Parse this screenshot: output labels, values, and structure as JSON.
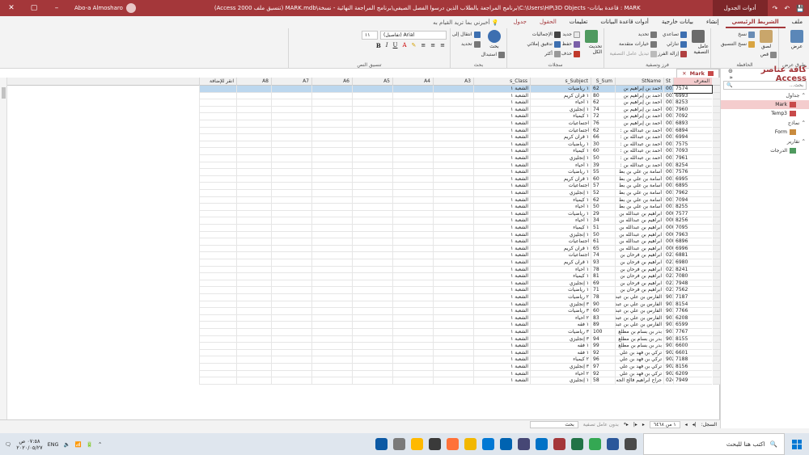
{
  "titlebar": {
    "title": "MARK : قاعدة بيانات- C:\\Users\\HP\\3D Objects\\برنامج المراجعة بالطلاب الذين درسوا الفصل الصيفي\\برنامج المراجعة النهائية - نسخة\\MARK.mdb (تنسيق ملف Access 2000)",
    "context_group": "أدوات الجدول",
    "user": "Abo-a Almosharo",
    "min": "–",
    "max": "▢",
    "close": "✕"
  },
  "tabs": [
    {
      "label": "ملف",
      "active": false
    },
    {
      "label": "الشريط الرئيسي",
      "active": true
    },
    {
      "label": "إنشاء",
      "active": false
    },
    {
      "label": "بيانات خارجية",
      "active": false
    },
    {
      "label": "أدوات قاعدة البيانات",
      "active": false
    },
    {
      "label": "تعليمات",
      "active": false
    },
    {
      "label": "الحقول",
      "active": false,
      "context": true
    },
    {
      "label": "جدول",
      "active": false,
      "context": true
    }
  ],
  "tell_me": "أخبرني بما تريد القيام به",
  "ribbon": {
    "views": {
      "label": "طرق عرض",
      "view_btn": "عرض"
    },
    "clipboard": {
      "label": "الحافظة",
      "paste": "لصق",
      "cut": "قص",
      "copy": "نسخ",
      "format_painter": "نسخ التنسيق"
    },
    "sort_filter": {
      "label": "فرز وتصفية",
      "filter": "عامل التصفية",
      "ascending": "تصاعدي",
      "descending": "تنازلي",
      "remove_sort": "إزالة الفرز",
      "selection": "تحديد",
      "advanced": "خيارات متقدمة",
      "toggle_filter": "تبديل عامل التصفية"
    },
    "records": {
      "label": "سجلات",
      "refresh": "تحديث الكل",
      "new": "جديد",
      "save": "حفظ",
      "delete": "حذف",
      "totals": "الإجماليات",
      "spelling": "تدقيق إملائي",
      "more": "أكثر"
    },
    "find": {
      "label": "بحث",
      "find": "بحث",
      "replace": "استبدال",
      "goto": "انتقال إلى",
      "select": "تحديد"
    },
    "text_format": {
      "label": "تنسيق النص",
      "font": "(تفاصيل) Arial",
      "size": "١١"
    }
  },
  "nav": {
    "title": "كافة عناصر Access",
    "search_placeholder": "بحث...",
    "sections": [
      {
        "label": "جداول",
        "items": [
          "Mark",
          "Temp3"
        ]
      },
      {
        "label": "نماذج",
        "items": [
          "Form"
        ]
      },
      {
        "label": "تقارير",
        "items": [
          "الدرجات"
        ]
      }
    ]
  },
  "doc_tab": "Mark",
  "columns": [
    "المعرف",
    "St",
    "StName",
    "S_Sum",
    "s_Subject",
    "s_Class",
    "A3",
    "A4",
    "A5",
    "A6",
    "A7",
    "A8",
    "انقر للإضافة"
  ],
  "rows": [
    [
      "7574",
      "0010",
      "أحمد بن إبراهيم بن",
      "62",
      "١ رياضيات",
      "الشعبة ١"
    ],
    [
      "6993",
      "0010",
      "أحمد بن إبراهيم بن",
      "80",
      "١ قرآن كريم",
      "الشعبة ١"
    ],
    [
      "8253",
      "0010",
      "أحمد بن إبراهيم بن",
      "62",
      "١ أحياء",
      "الشعبة ١"
    ],
    [
      "7960",
      "0010",
      "أحمد بن إبراهيم بن",
      "74",
      "١ إنجليزي",
      "الشعبة ١"
    ],
    [
      "7092",
      "0010",
      "أحمد بن إبراهيم بن",
      "72",
      "١ كيمياء",
      "الشعبة ١"
    ],
    [
      "6893",
      "0010",
      "أحمد بن إبراهيم بن",
      "76",
      "اجتماعيات",
      "الشعبة ١"
    ],
    [
      "6894",
      "0013",
      "أحمد بن عبدالله بن :",
      "62",
      "اجتماعيات",
      "الشعبة ١"
    ],
    [
      "6994",
      "0013",
      "أحمد بن عبدالله بن :",
      "66",
      "١ قرآن كريم",
      "الشعبة ١"
    ],
    [
      "7575",
      "0013",
      "أحمد بن عبدالله بن :",
      "30",
      "١ رياضيات",
      "الشعبة ١"
    ],
    [
      "7093",
      "0013",
      "أحمد بن عبدالله بن :",
      "60",
      "١ كيمياء",
      "الشعبة ١"
    ],
    [
      "7961",
      "0013",
      "أحمد بن عبدالله بن :",
      "50",
      "١ إنجليزي",
      "الشعبة ١"
    ],
    [
      "8254",
      "0013",
      "أحمد بن عبدالله بن :",
      "39",
      "١ أحياء",
      "الشعبة ١"
    ],
    [
      "7576",
      "0015",
      "أسامة بن علي بن بط",
      "55",
      "١ رياضيات",
      "الشعبة ١"
    ],
    [
      "6995",
      "0015",
      "أسامة بن علي بن بط",
      "60",
      "١ قرآن كريم",
      "الشعبة ١"
    ],
    [
      "6895",
      "0015",
      "أسامة بن علي بن بط",
      "57",
      "اجتماعيات",
      "الشعبة ١"
    ],
    [
      "7962",
      "0015",
      "أسامة بن علي بن بط",
      "52",
      "١ إنجليزي",
      "الشعبة ١"
    ],
    [
      "7094",
      "0015",
      "أسامة بن علي بن بط",
      "62",
      "١ كيمياء",
      "الشعبة ١"
    ],
    [
      "8255",
      "0015",
      "أسامة بن علي بن بط",
      "50",
      "١ أحياء",
      "الشعبة ١"
    ],
    [
      "7577",
      "0001",
      "ابراهيم بن عبدالله بن",
      "29",
      "١ رياضيات",
      "الشعبة ١"
    ],
    [
      "8256",
      "0001",
      "ابراهيم بن عبدالله بن",
      "34",
      "١ أحياء",
      "الشعبة ١"
    ],
    [
      "7095",
      "0001",
      "ابراهيم بن عبدالله بن",
      "51",
      "١ كيمياء",
      "الشعبة ١"
    ],
    [
      "7963",
      "0001",
      "ابراهيم بن عبدالله بن",
      "50",
      "١ إنجليزي",
      "الشعبة ١"
    ],
    [
      "6896",
      "0001",
      "ابراهيم بن عبدالله بن",
      "61",
      "اجتماعيات",
      "الشعبة ١"
    ],
    [
      "6996",
      "0001",
      "ابراهيم بن عبدالله بن",
      "65",
      "١ قرآن كريم",
      "الشعبة ١"
    ],
    [
      "6881",
      "0239",
      "ابراهيم بن فرحان بن",
      "74",
      "اجتماعيات",
      "الشعبة ١"
    ],
    [
      "6980",
      "0239",
      "ابراهيم بن فرحان بن",
      "93",
      "١ قرآن كريم",
      "الشعبة ١"
    ],
    [
      "8241",
      "0239",
      "ابراهيم بن فرحان بن",
      "78",
      "١ أحياء",
      "الشعبة ١"
    ],
    [
      "7080",
      "0239",
      "ابراهيم بن فرحان بن",
      "81",
      "١ كيمياء",
      "الشعبة ١"
    ],
    [
      "7948",
      "0239",
      "ابراهيم بن فرحان بن",
      "69",
      "١ إنجليزي",
      "الشعبة ١"
    ],
    [
      "7562",
      "0239",
      "ابراهيم بن فرحان بن",
      "71",
      "١ رياضيات",
      "الشعبة ١"
    ],
    [
      "7187",
      "9013",
      "الفارس بن علي بن عبد",
      "78",
      "٢ رياضيات",
      "الشعبة ١"
    ],
    [
      "8154",
      "9013",
      "الفارس بن علي بن عبد",
      "90",
      "٣ إنجليزي",
      "الشعبة ١"
    ],
    [
      "7766",
      "9013",
      "الفارس بن علي بن عبد",
      "60",
      "٣ رياضيات",
      "الشعبة ١"
    ],
    [
      "6208",
      "9013",
      "الفارس بن علي بن عبد",
      "83",
      "٢ أحياء",
      "الشعبة ١"
    ],
    [
      "6599",
      "9013",
      "الفارس بن علي بن عبد",
      "89",
      "١ فقه",
      "الشعبة ١"
    ],
    [
      "7767",
      "9018",
      "بدر بن بسام بن مطلع",
      "100",
      "٣ رياضيات",
      "الشعبة ١"
    ],
    [
      "8155",
      "9018",
      "بدر بن بسام بن مطلع",
      "94",
      "٣ إنجليزي",
      "الشعبة ١"
    ],
    [
      "6600",
      "9018",
      "بدر بن بسام بن مطلع",
      "99",
      "١ فقه",
      "الشعبة ١"
    ],
    [
      "6601",
      "9026",
      "تركي بن فهد بن علي",
      "92",
      "١ فقه",
      "الشعبة ١"
    ],
    [
      "7188",
      "9026",
      "تركي بن فهد بن علي",
      "96",
      "٢ كيمياء",
      "الشعبة ١"
    ],
    [
      "8156",
      "9026",
      "تركي بن فهد بن علي",
      "97",
      "٣ إنجليزي",
      "الشعبة ١"
    ],
    [
      "6209",
      "9026",
      "تركي بن فهد بن علي",
      "92",
      "٢ أحياء",
      "الشعبة ١"
    ],
    [
      "7949",
      "0243",
      "جراح ابراهيم فالح الجه",
      "58",
      "١ إنجليزي",
      "الشعبة ١"
    ]
  ],
  "record_nav": {
    "label": "السجل:",
    "position": "١ من ٦٤٦٨",
    "no_filter": "بدون عامل تصفية",
    "search": "بحث"
  },
  "taskbar": {
    "search": "اكتب هنا للبحث",
    "lang": "ENG",
    "time": "٠٧:٥٨ ص",
    "date": "٢٠٢٠/٠٥/٢٧",
    "apps": [
      {
        "name": "task-view",
        "color": "#4a4a4a"
      },
      {
        "name": "word",
        "color": "#2b579a"
      },
      {
        "name": "chrome",
        "color": "#34a853"
      },
      {
        "name": "excel",
        "color": "#217346"
      },
      {
        "name": "access",
        "color": "#a4373a"
      },
      {
        "name": "outlook",
        "color": "#0072c6"
      },
      {
        "name": "teams",
        "color": "#464775"
      },
      {
        "name": "mail",
        "color": "#0063b1"
      },
      {
        "name": "store",
        "color": "#0078d4"
      },
      {
        "name": "file-explorer",
        "color": "#f2b700"
      },
      {
        "name": "firefox",
        "color": "#ff7139"
      },
      {
        "name": "app-2",
        "color": "#3a3a3a"
      },
      {
        "name": "app-3",
        "color": "#ffb900"
      },
      {
        "name": "app-4",
        "color": "#7a7a7a"
      },
      {
        "name": "edge",
        "color": "#0c59a4"
      }
    ]
  }
}
